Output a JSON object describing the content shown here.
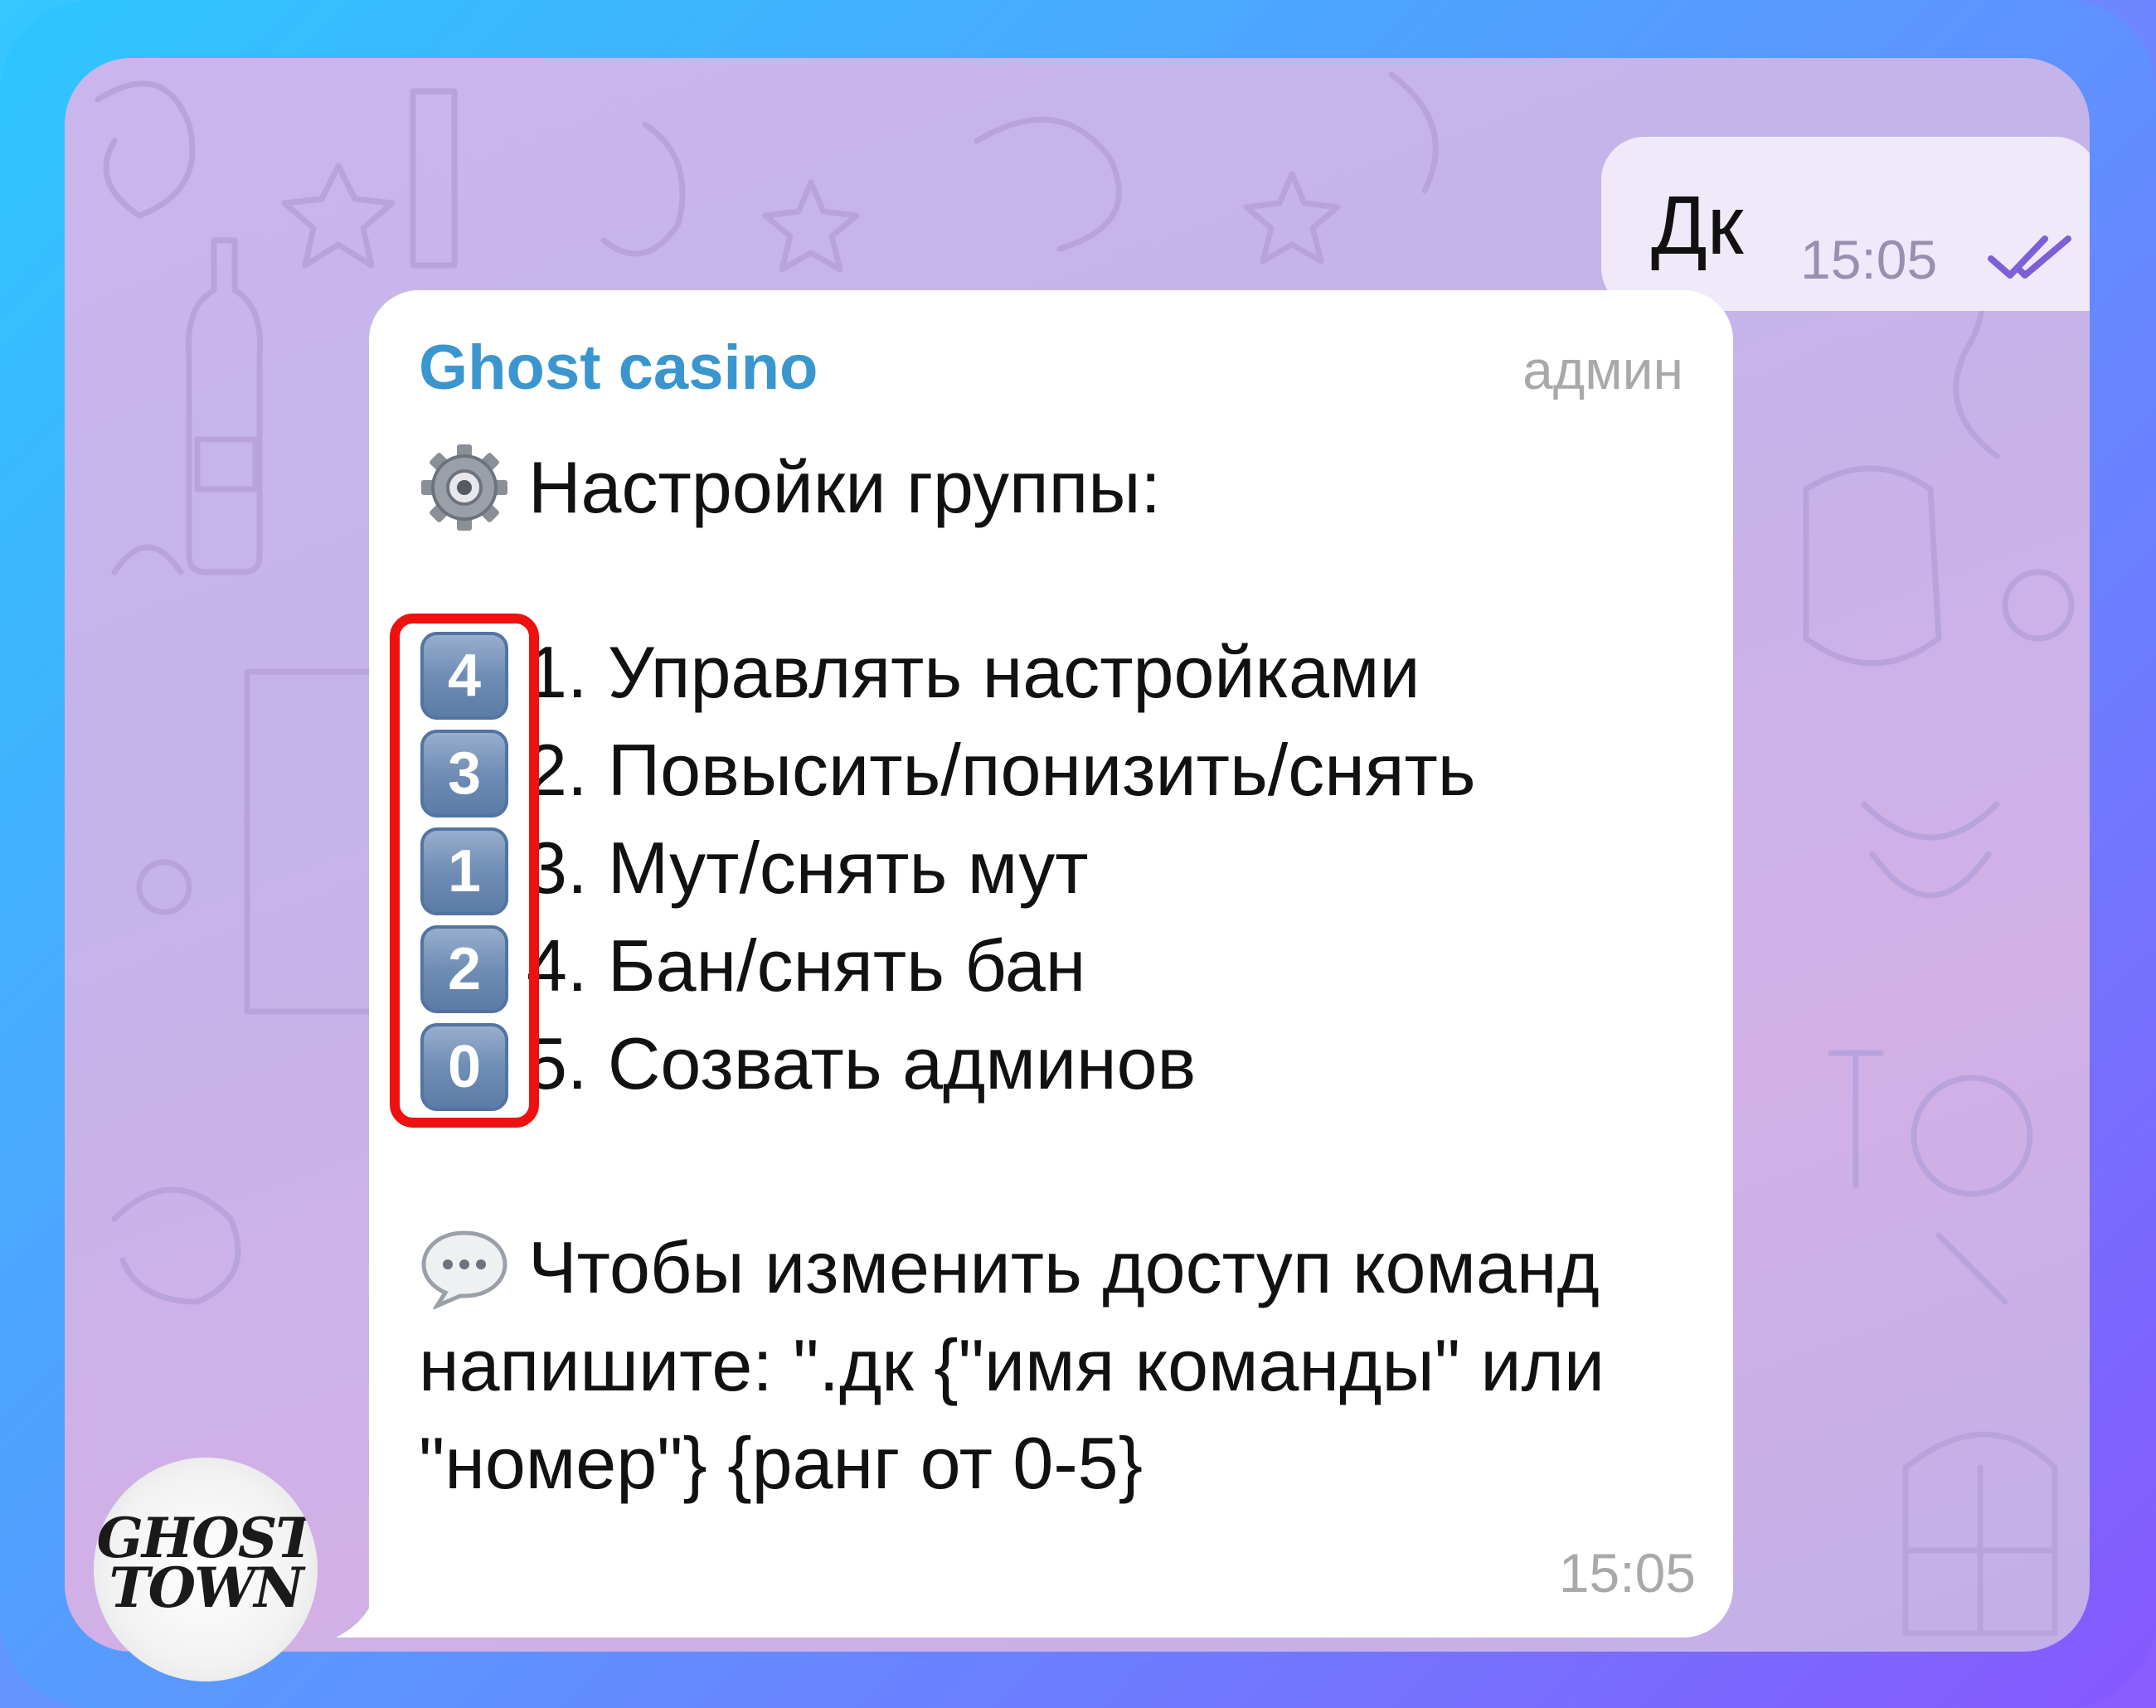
{
  "outgoing": {
    "text": "Дк",
    "time": "15:05",
    "status_icon": "double-check-icon"
  },
  "incoming": {
    "sender": "Ghost casino",
    "role": "админ",
    "header_icon": "gear-icon",
    "header": "Настройки группы:",
    "items": [
      {
        "key": "4",
        "text": "1. Управлять настройками"
      },
      {
        "key": "3",
        "text": "2. Повысить/понизить/снять"
      },
      {
        "key": "1",
        "text": "3. Мут/снять мут"
      },
      {
        "key": "2",
        "text": "4. Бан/снять бан"
      },
      {
        "key": "0",
        "text": "5. Созвать админов"
      }
    ],
    "note_icon": "speech-bubble-icon",
    "note": "Чтобы изменить доступ команд напишите: \".дк {\"имя команды\" или \"номер\"} {ранг от 0-5}",
    "time": "15:05"
  },
  "avatar": {
    "line1": "GHOST",
    "line2": "TOWN"
  },
  "colors": {
    "sender": "#3a96cf",
    "highlight": "#ef1010",
    "keycap": "#6f8db5",
    "check": "#7d5fd6"
  }
}
